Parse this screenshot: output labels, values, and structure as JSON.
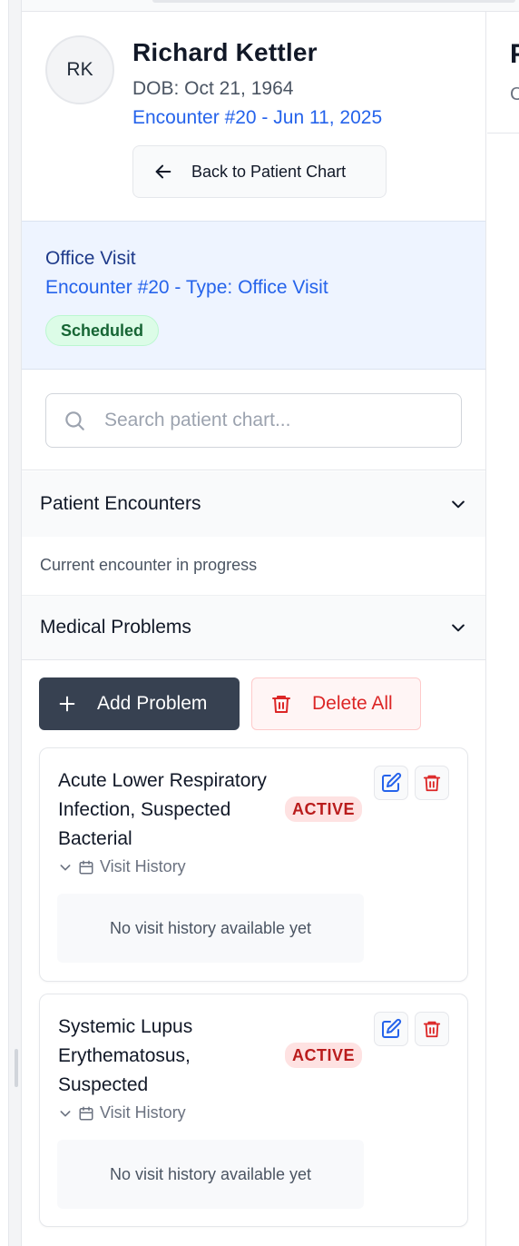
{
  "patient": {
    "initials": "RK",
    "name": "Richard Kettler",
    "dob": "DOB: Oct 21, 1964",
    "encounter_link": "Encounter #20 - Jun 11, 2025"
  },
  "header": {
    "back_label": "Back to Patient Chart"
  },
  "encounter": {
    "title": "Office Visit",
    "subtitle": "Encounter #20 - Type: Office Visit",
    "status": "Scheduled"
  },
  "search": {
    "placeholder": "Search patient chart...",
    "value": ""
  },
  "sections": {
    "encounters_title": "Patient Encounters",
    "encounters_status": "Current encounter in progress",
    "problems_title": "Medical Problems"
  },
  "actions": {
    "add_label": "Add Problem",
    "delete_all_label": "Delete All"
  },
  "problems": [
    {
      "name": "Acute Lower Respiratory Infection, Suspected Bacterial",
      "status": "ACTIVE",
      "history_label": "Visit History",
      "history_empty": "No visit history available yet"
    },
    {
      "name": "Systemic Lupus Erythematosus, Suspected",
      "status": "ACTIVE",
      "history_label": "Visit History",
      "history_empty": "No visit history available yet"
    }
  ],
  "colors": {
    "link_blue": "#2563eb",
    "banner_bg": "#eef4ff",
    "success_green": "#166534",
    "danger_red": "#dc2626",
    "primary_dark": "#374151"
  },
  "icons": {
    "back": "arrow-left-icon",
    "search": "search-icon",
    "chevron": "chevron-down-icon",
    "add": "plus-icon",
    "delete": "trash-icon",
    "edit": "edit-icon",
    "calendar": "calendar-icon"
  }
}
